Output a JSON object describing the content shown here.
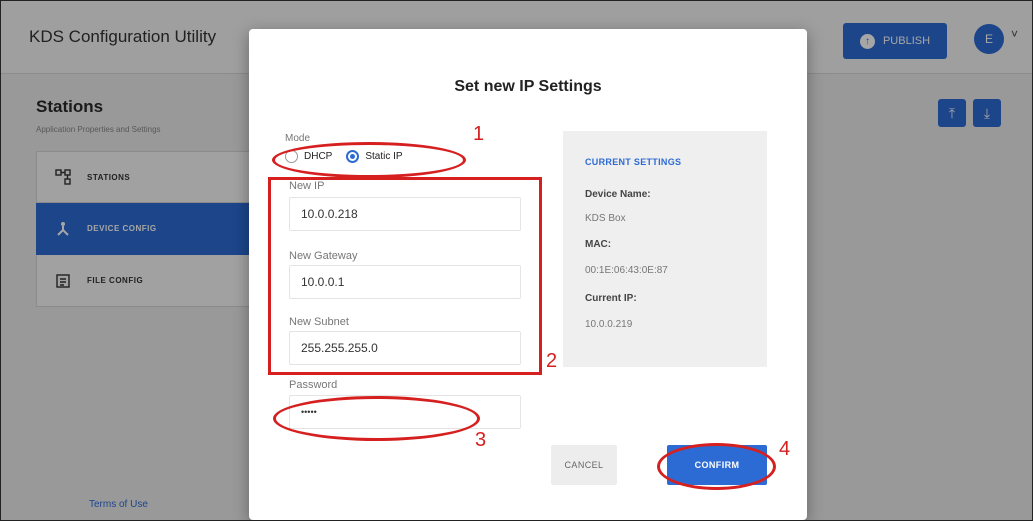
{
  "app": {
    "title": "KDS Configuration Utility",
    "publish_label": "PUBLISH",
    "avatar_initial": "E",
    "accent": "#2d6bd4"
  },
  "sidebar": {
    "heading": "Stations",
    "subheading": "Application Properties and Settings",
    "items": [
      {
        "label": "STATIONS",
        "icon": "stations-icon",
        "active": false
      },
      {
        "label": "DEVICE CONFIG",
        "icon": "device-config-icon",
        "active": true
      },
      {
        "label": "FILE CONFIG",
        "icon": "file-config-icon",
        "active": false
      }
    ],
    "terms": "Terms of Use"
  },
  "toolbar": {
    "upload_icon": "upload-icon",
    "download_icon": "download-icon"
  },
  "dialog": {
    "title": "Set new IP Settings",
    "mode_label": "Mode",
    "mode_options": [
      "DHCP",
      "Static IP"
    ],
    "mode_selected": "Static IP",
    "new_ip_label": "New IP",
    "new_ip_value": "10.0.0.218",
    "gateway_label": "New Gateway",
    "gateway_value": "10.0.0.1",
    "subnet_label": "New Subnet",
    "subnet_value": "255.255.255.0",
    "password_label": "Password",
    "password_value": "•••••",
    "cancel_label": "CANCEL",
    "confirm_label": "CONFIRM"
  },
  "current_settings": {
    "heading": "CURRENT SETTINGS",
    "device_name_label": "Device Name:",
    "device_name_value": "KDS Box",
    "mac_label": "MAC:",
    "mac_value": "00:1E:06:43:0E:87",
    "current_ip_label": "Current IP:",
    "current_ip_value": "10.0.0.219"
  },
  "annotations": {
    "color": "#d62020",
    "labels": [
      "1",
      "2",
      "3",
      "4"
    ]
  }
}
